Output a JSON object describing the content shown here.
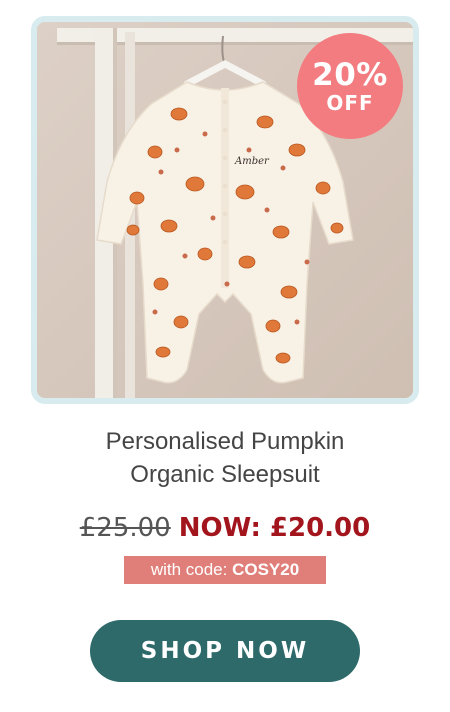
{
  "product": {
    "image_alt": "Baby sleepsuit with pumpkin print hanging on a white wooden rail",
    "embroidered_name": "Amber",
    "badge": {
      "percent": "20%",
      "off": "OFF"
    },
    "title_line1": "Personalised Pumpkin",
    "title_line2": "Organic Sleepsuit",
    "old_price": "£25.00",
    "new_price": "NOW: £20.00",
    "code_prefix": "with code: ",
    "code": "COSY20"
  },
  "cta": {
    "label": "SHOP NOW"
  },
  "colors": {
    "badge": "#f27c80",
    "new_price": "#a3151c",
    "code_chip": "#e07f79",
    "button": "#2d6a69",
    "frame": "#d8ecef"
  }
}
